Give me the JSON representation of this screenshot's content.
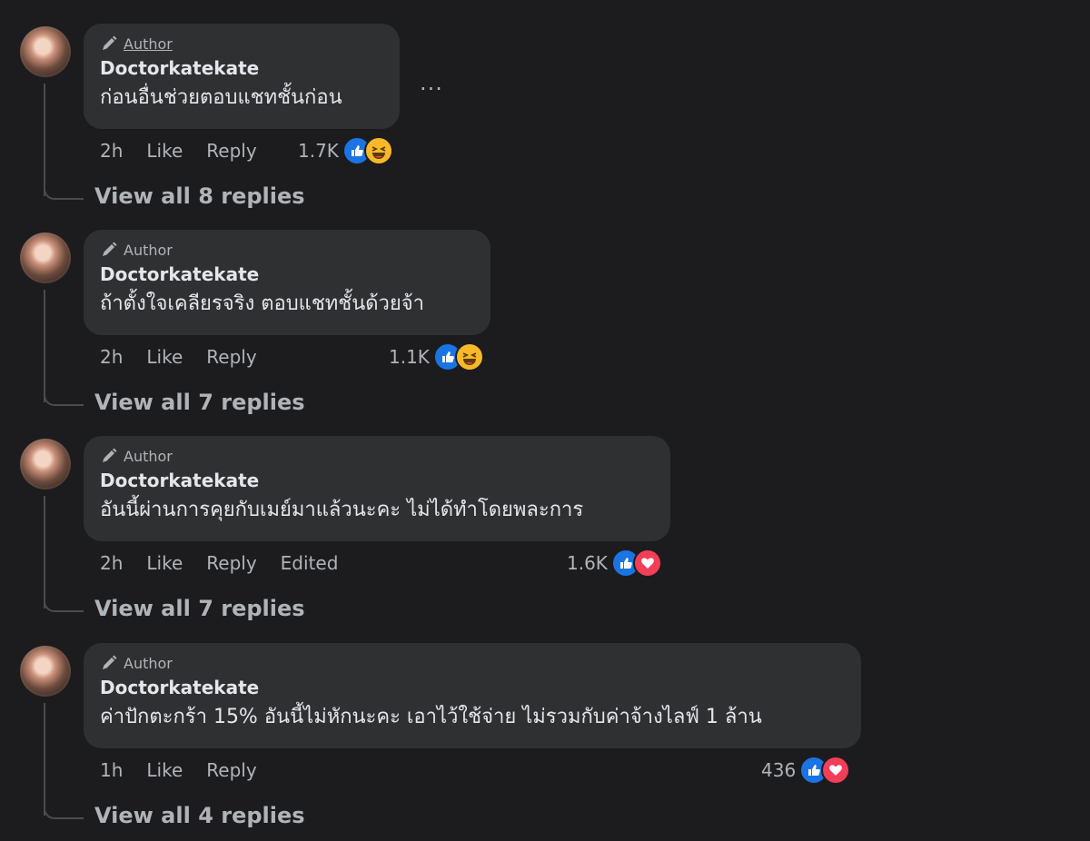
{
  "comments": [
    {
      "author_badge": "Author",
      "author_badge_underlined": true,
      "name": "Doctorkatekate",
      "text": "ก่อนอื่นช่วยตอบแชทชั้นก่อน",
      "time": "2h",
      "like_label": "Like",
      "reply_label": "Reply",
      "edited_label": "",
      "reaction_count": "1.7K",
      "reactions": [
        "like-icon",
        "haha-icon"
      ],
      "view_replies": "View all 8 replies",
      "has_more_menu": true
    },
    {
      "author_badge": "Author",
      "name": "Doctorkatekate",
      "text": "ถ้าตั้งใจเคลียรจริง ตอบแชทชั้นด้วยจ้า",
      "time": "2h",
      "like_label": "Like",
      "reply_label": "Reply",
      "edited_label": "",
      "reaction_count": "1.1K",
      "reactions": [
        "like-icon",
        "haha-icon"
      ],
      "view_replies": "View all 7 replies"
    },
    {
      "author_badge": "Author",
      "name": "Doctorkatekate",
      "text": "อันนี้ผ่านการคุยกับเมย์มาแล้วนะคะ ไม่ได้ทำโดยพละการ",
      "time": "2h",
      "like_label": "Like",
      "reply_label": "Reply",
      "edited_label": "Edited",
      "reaction_count": "1.6K",
      "reactions": [
        "like-icon",
        "love-icon"
      ],
      "view_replies": "View all 7 replies"
    },
    {
      "author_badge": "Author",
      "name": "Doctorkatekate",
      "text": "ค่าปักตะกร้า 15% อันนี้ไม่หักนะคะ เอาไว้ใช้จ่าย ไม่รวมกับค่าจ้างไลฟ์ 1 ล้าน",
      "time": "1h",
      "like_label": "Like",
      "reply_label": "Reply",
      "edited_label": "",
      "reaction_count": "436",
      "reactions": [
        "like-icon",
        "love-icon"
      ],
      "view_replies": "View all 4 replies"
    }
  ],
  "more_menu_label": "···",
  "colors": {
    "background": "#1c1c1e",
    "bubble": "#2f3032",
    "like": "#1b74e4",
    "haha": "#f7b928",
    "love": "#f33e58"
  }
}
